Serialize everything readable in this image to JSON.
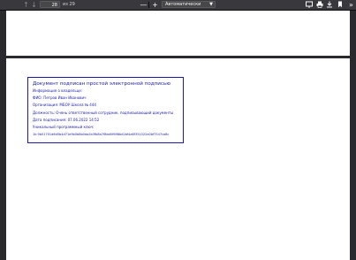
{
  "toolbar": {
    "current_page": "28",
    "total_pages": "из 29",
    "zoom_value": "Автоматически",
    "icons": [
      "previous-page-icon",
      "next-page-icon",
      "zoom-out-icon",
      "zoom-in-icon",
      "presentation-mode-icon",
      "print-icon",
      "save-icon",
      "bookmark-icon",
      "tools-icon"
    ]
  },
  "stamp": {
    "title": "Документ подписан простой электронной подписью",
    "info_header": "Информация о владельце:",
    "fio": "ФИО: Петров Иван Иванович",
    "org": "Организация: МБОУ Школа № 444",
    "position": "Должность: Очень ответственный сотрудник, подписывающий документы",
    "date": "Дата подписания: 07.06.2022 14:52",
    "key_label": "Уникальный программный ключ:",
    "key": "1b 9b01701d6d5b4d71e9b0b8b0da2b3fb8a7f8bd0f698bd2bf4a6f351022a0bf7547ca8c"
  },
  "colors": {
    "toolbar_bg": "#38383d",
    "viewer_bg": "#2a2a2e",
    "stamp_blue": "#1a1aa6"
  }
}
